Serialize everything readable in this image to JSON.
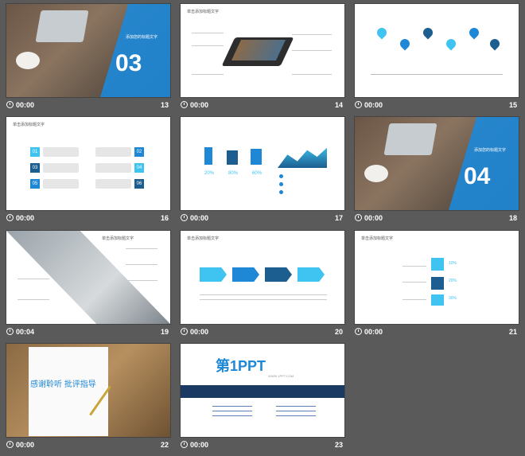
{
  "slides": [
    {
      "num": "13",
      "time": "00:00",
      "overlay": "03",
      "caption": "添加您的标题文字"
    },
    {
      "num": "14",
      "time": "00:00",
      "title": "单击添加标题文字"
    },
    {
      "num": "15",
      "time": "00:00"
    },
    {
      "num": "16",
      "time": "00:00",
      "title": "单击添加标题文字",
      "boxes": [
        "01",
        "02",
        "03",
        "04",
        "05",
        "06"
      ]
    },
    {
      "num": "17",
      "time": "00:00",
      "pcts": [
        "20%",
        "80%",
        "60%"
      ]
    },
    {
      "num": "18",
      "time": "00:00",
      "overlay": "04",
      "caption": "添加您的标题文字"
    },
    {
      "num": "19",
      "time": "00:04",
      "title": "单击添加标题文字"
    },
    {
      "num": "20",
      "time": "00:00",
      "title": "单击添加标题文字"
    },
    {
      "num": "21",
      "time": "00:00",
      "title": "单击添加标题文字",
      "pcts": [
        "10%",
        "20%",
        "30%"
      ]
    },
    {
      "num": "22",
      "time": "00:00",
      "thanks": "感谢聆听 批评指导"
    },
    {
      "num": "23",
      "time": "00:00",
      "logo": "第1PPT",
      "logo_url": "WWW.1PPT.COM"
    }
  ]
}
